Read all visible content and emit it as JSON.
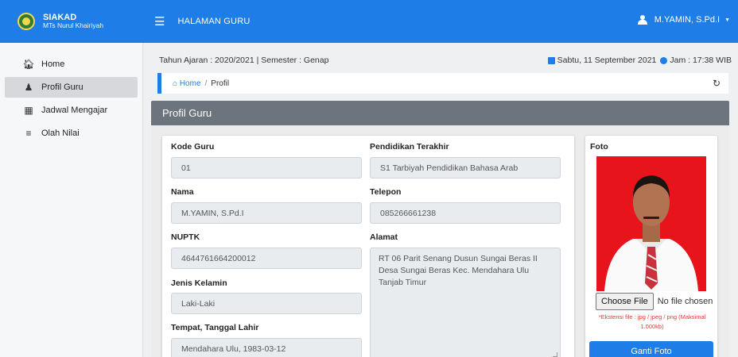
{
  "brand": {
    "title": "SIAKAD",
    "subtitle": "MTs Nurul Khairiyah"
  },
  "topbar": {
    "menu_icon": "hamburger-icon",
    "title": "HALAMAN GURU",
    "user_name": "M.YAMIN, S.Pd.I",
    "user_icon": "user-icon"
  },
  "sidebar": {
    "items": [
      {
        "label": "Home",
        "icon": "home-icon"
      },
      {
        "label": "Profil Guru",
        "icon": "user-tie-icon"
      },
      {
        "label": "Jadwal Mengajar",
        "icon": "calendar-icon"
      },
      {
        "label": "Olah Nilai",
        "icon": "list-icon"
      }
    ]
  },
  "info": {
    "academic": "Tahun Ajaran : 2020/2021 | Semester : Genap",
    "date": "Sabtu, 11 September 2021",
    "time": "Jam : 17:38 WIB"
  },
  "breadcrumb": {
    "home": "Home",
    "sep": "/",
    "current": "Profil"
  },
  "panel": {
    "title": "Profil Guru"
  },
  "profile": {
    "kode_label": "Kode Guru",
    "kode": "01",
    "nama_label": "Nama",
    "nama": "M.YAMIN, S.Pd.I",
    "nuptk_label": "NUPTK",
    "nuptk": "4644761664200012",
    "jk_label": "Jenis Kelamin",
    "jk": "Laki-Laki",
    "ttl_label": "Tempat, Tanggal Lahir",
    "ttl": "Mendahara Ulu, 1983-03-12",
    "pendidikan_label": "Pendidikan Terakhir",
    "pendidikan": "S1 Tarbiyah Pendidikan Bahasa Arab",
    "telepon_label": "Telepon",
    "telepon": "085266661238",
    "alamat_label": "Alamat",
    "alamat": "RT 06 Parit Senang Dusun Sungai Beras II Desa Sungai Beras Kec. Mendahara Ulu Tanjab Timur"
  },
  "photo": {
    "label": "Foto",
    "choose_label": "Choose File",
    "file_status": "No file chosen",
    "note": "*Ekstensi file : jpg / jpeg / png (Maksimal 1.000kb)",
    "submit_label": "Ganti Foto"
  },
  "colors": {
    "primary": "#1e7de6",
    "panel_header": "#6c757d",
    "photo_bg": "#e8141b",
    "note": "#e53935"
  }
}
